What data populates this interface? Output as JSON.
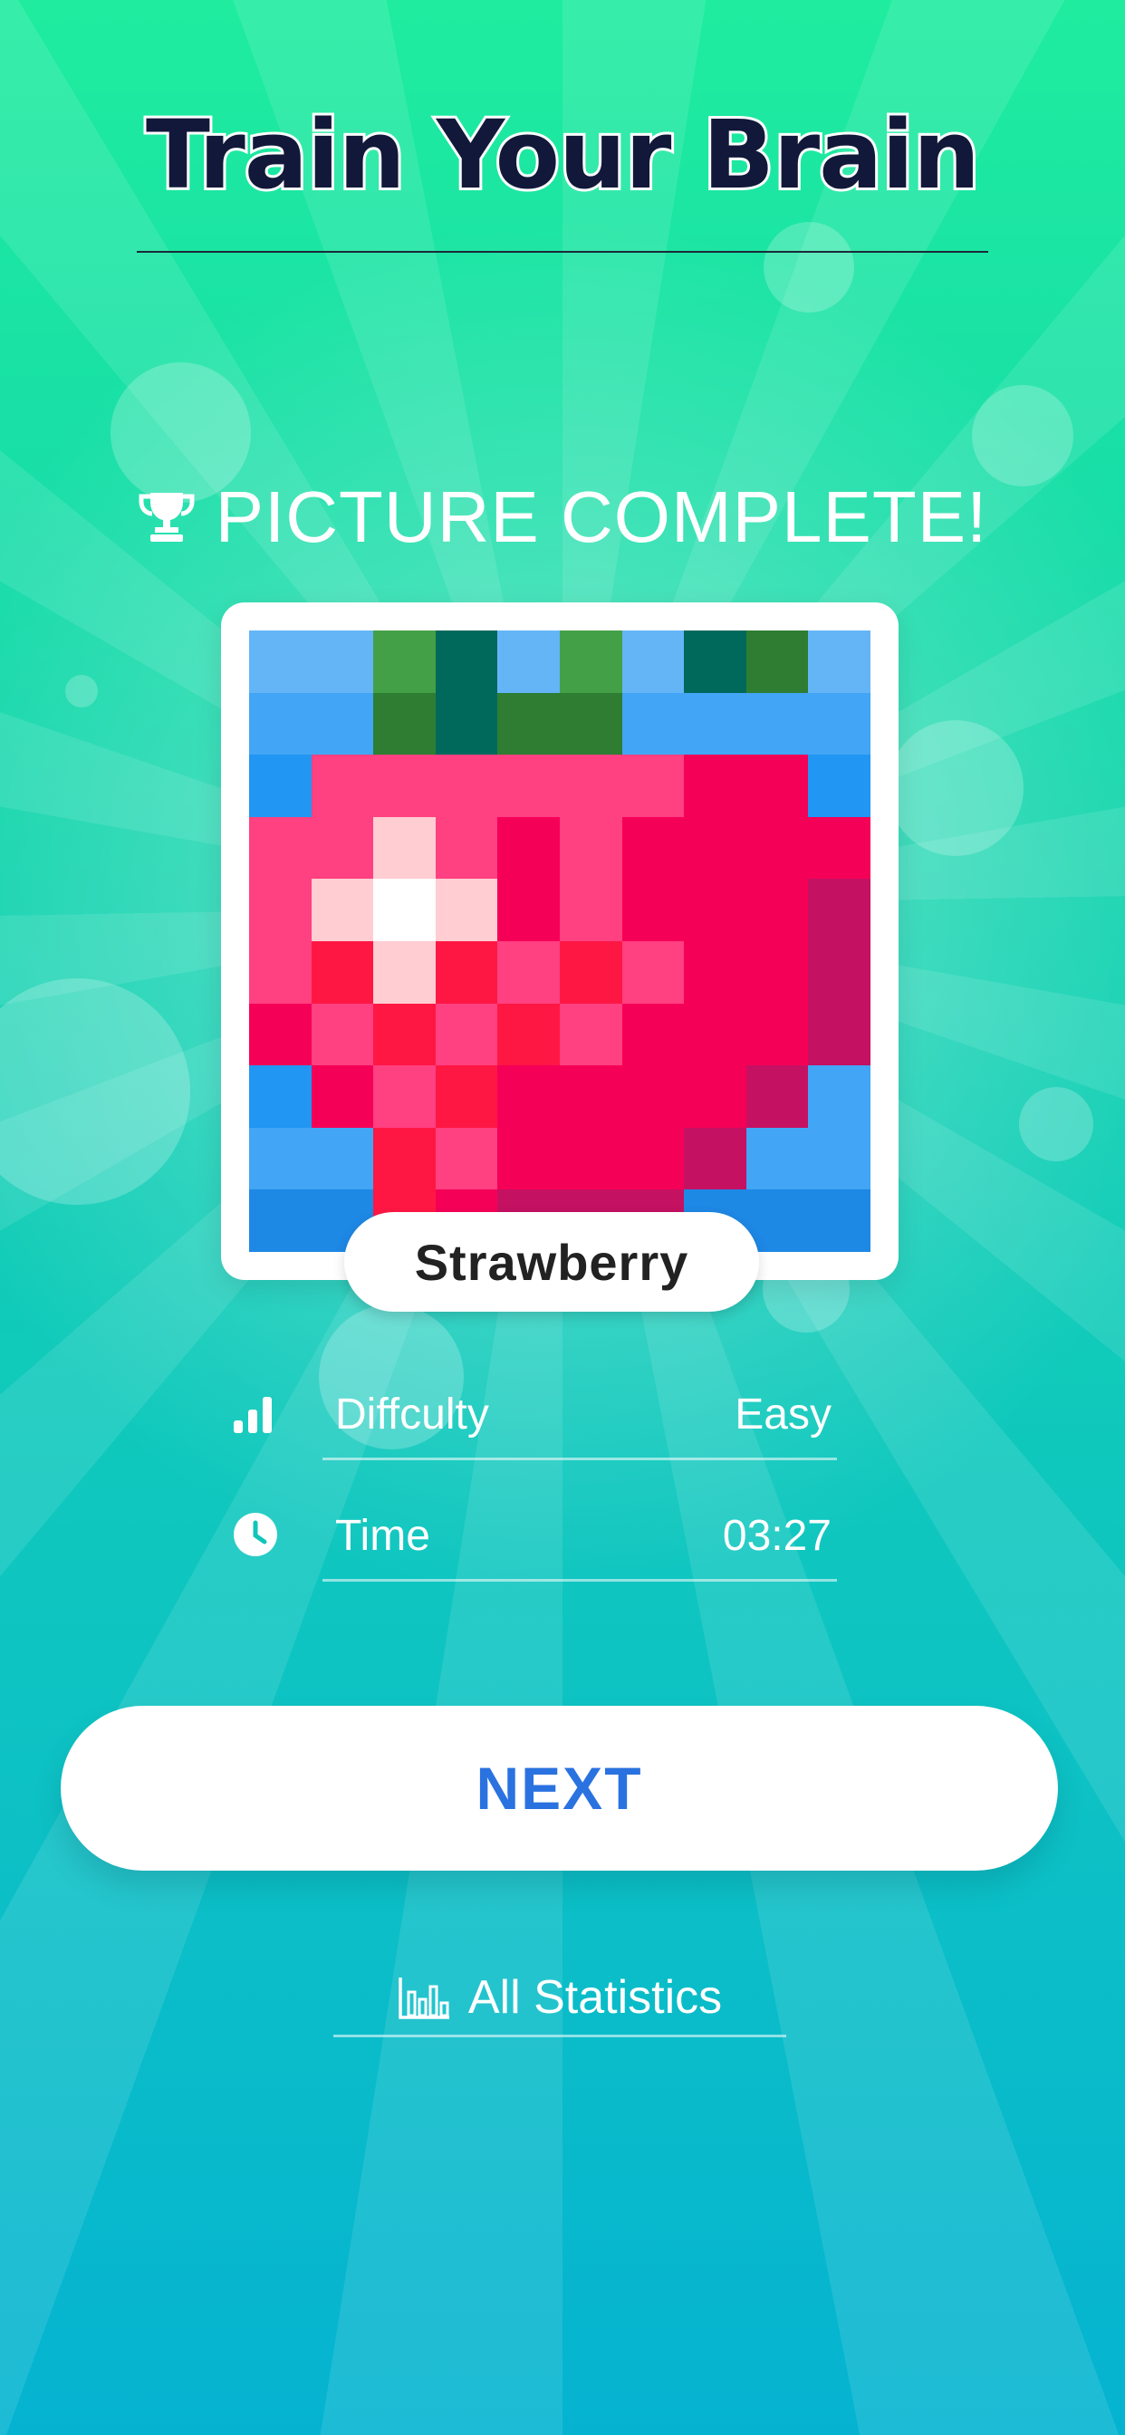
{
  "header": {
    "title": "Train Your Brain"
  },
  "result": {
    "headline": "PICTURE COMPLETE!",
    "trophy_icon": "trophy-icon",
    "picture_name": "Strawberry"
  },
  "stats": [
    {
      "icon": "signal-bars-icon",
      "label": "Diffculty",
      "value": "Easy"
    },
    {
      "icon": "clock-icon",
      "label": "Time",
      "value": "03:27"
    }
  ],
  "actions": {
    "next_label": "NEXT",
    "all_statistics_label": "All Statistics",
    "all_statistics_icon": "bar-chart-icon"
  },
  "colors": {
    "accent_blue": "#2a72e0",
    "title_ink": "#12183a",
    "background_top": "#1fec9f",
    "background_bottom": "#05b3d1"
  },
  "pixel_art": {
    "palette": {
      "a": "#64b5f6",
      "b": "#42a5f5",
      "c": "#2196f3",
      "d": "#1e88e5",
      "g": "#43a047",
      "G": "#2e7d32",
      "t": "#00695c",
      "p": "#ff4081",
      "P": "#ff5c8d",
      "r": "#ff1744",
      "R": "#f50057",
      "m": "#c51162",
      "w": "#ffffff",
      "l": "#ffcdd2"
    },
    "rows": [
      "aagtagatGa",
      "bbGtGGbbbb",
      "cppppppRRc",
      "pplpRpRRRR",
      "plwlRpRRRm",
      "prlrprpRRm",
      "RprprpRRRm",
      "cRprRRRRmb",
      "bbrpRRRmbb",
      "ddrRmmmddd"
    ]
  }
}
